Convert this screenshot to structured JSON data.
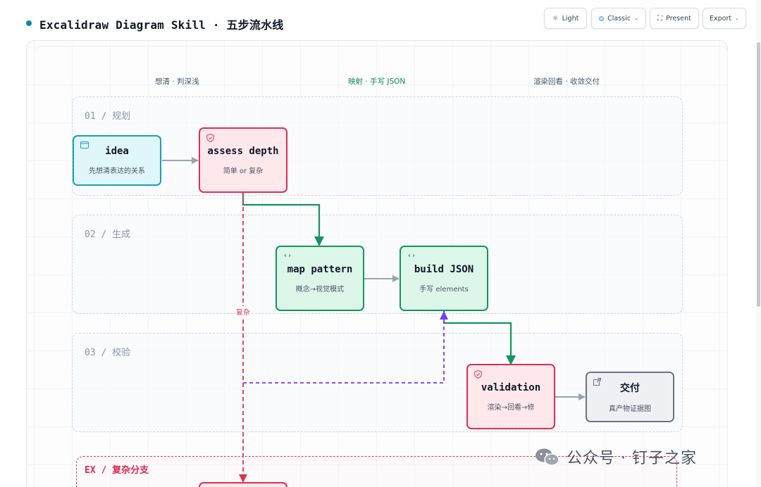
{
  "header": {
    "title": "Excalidraw Diagram Skill · 五步流水线",
    "buttons": [
      {
        "label": "Light",
        "icon": "sun-icon"
      },
      {
        "label": "Classic",
        "icon": "palette-swatch-icon",
        "chevron": "⌄"
      },
      {
        "label": "Present",
        "icon": "fullscreen-icon"
      },
      {
        "label": "Export",
        "chevron": "⌄"
      }
    ]
  },
  "lanes": [
    "想清 · 判深浅",
    "映射 · 手写 JSON",
    "渲染回看 · 收敛交付"
  ],
  "stages": [
    {
      "label": "01 / 规划"
    },
    {
      "label": "02 / 生成"
    },
    {
      "label": "03 / 校验"
    },
    {
      "label": "EX / 复杂分支"
    }
  ],
  "nodes": [
    {
      "title": "idea",
      "subtitle": "先想清表达的关系",
      "icon": "browser-window-icon"
    },
    {
      "title": "assess depth",
      "subtitle": "简单 or 复杂",
      "icon": "shield-icon"
    },
    {
      "title": "map pattern",
      "subtitle": "概念→视觉模式",
      "icon": "code-brackets-icon"
    },
    {
      "title": "build JSON",
      "subtitle": "手写 elements",
      "icon": "code-brackets-icon"
    },
    {
      "title": "validation",
      "subtitle": "渲染→回看→修",
      "icon": "shield-icon"
    },
    {
      "title": "交付",
      "subtitle": "真产物证据图",
      "icon": "external-link-icon"
    }
  ],
  "edge_labels": {
    "complex": "复杂"
  },
  "watermark": {
    "text": "公众号 · 钉子之家",
    "icon": "wechat-icon"
  },
  "colors": {
    "accent": "#0b8aa8",
    "green": "#14955f",
    "red": "#dc2f55",
    "purple": "#7c3aed",
    "gray_arrow": "#9aa3b2"
  }
}
